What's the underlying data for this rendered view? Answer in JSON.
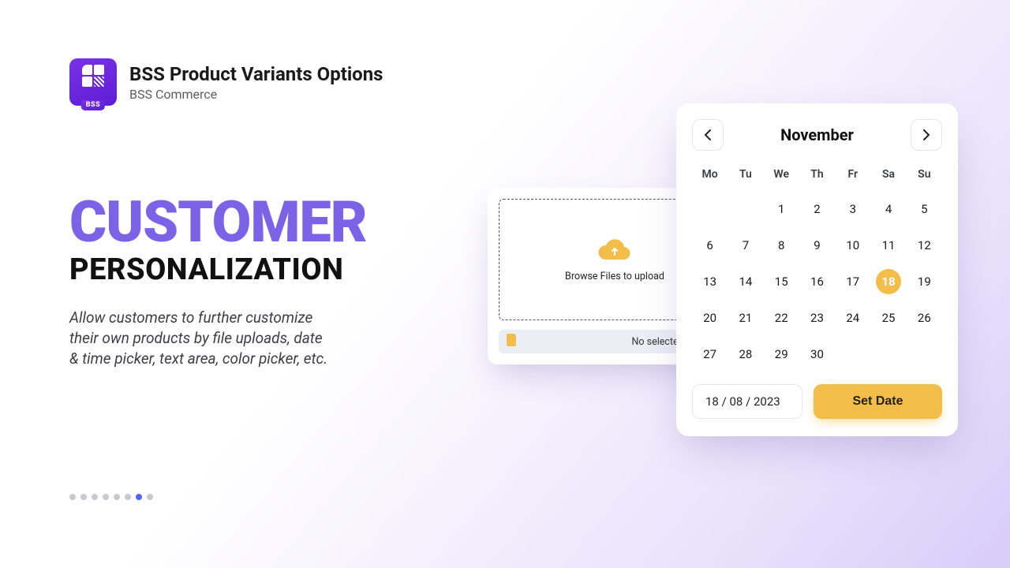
{
  "header": {
    "logo_text": "BSS",
    "title": "BSS Product Variants Options",
    "subtitle": "BSS Commerce"
  },
  "hero": {
    "title_line1": "CUSTOMER",
    "title_line2": "PERSONALIZATION",
    "description": "Allow customers to further customize their own products by file uploads, date & time picker, text area, color picker, etc."
  },
  "upload": {
    "dropzone_text": "Browse Files to upload",
    "status_text": "No selected File -"
  },
  "calendar": {
    "month_label": "November",
    "dow": [
      "Mo",
      "Tu",
      "We",
      "Th",
      "Fr",
      "Sa",
      "Su"
    ],
    "leading_blanks": 2,
    "days_in_month": 30,
    "selected_day": 18,
    "date_input_value": "18 / 08 / 2023",
    "set_date_label": "Set Date"
  },
  "pagination": {
    "count": 8,
    "active_index": 6
  }
}
